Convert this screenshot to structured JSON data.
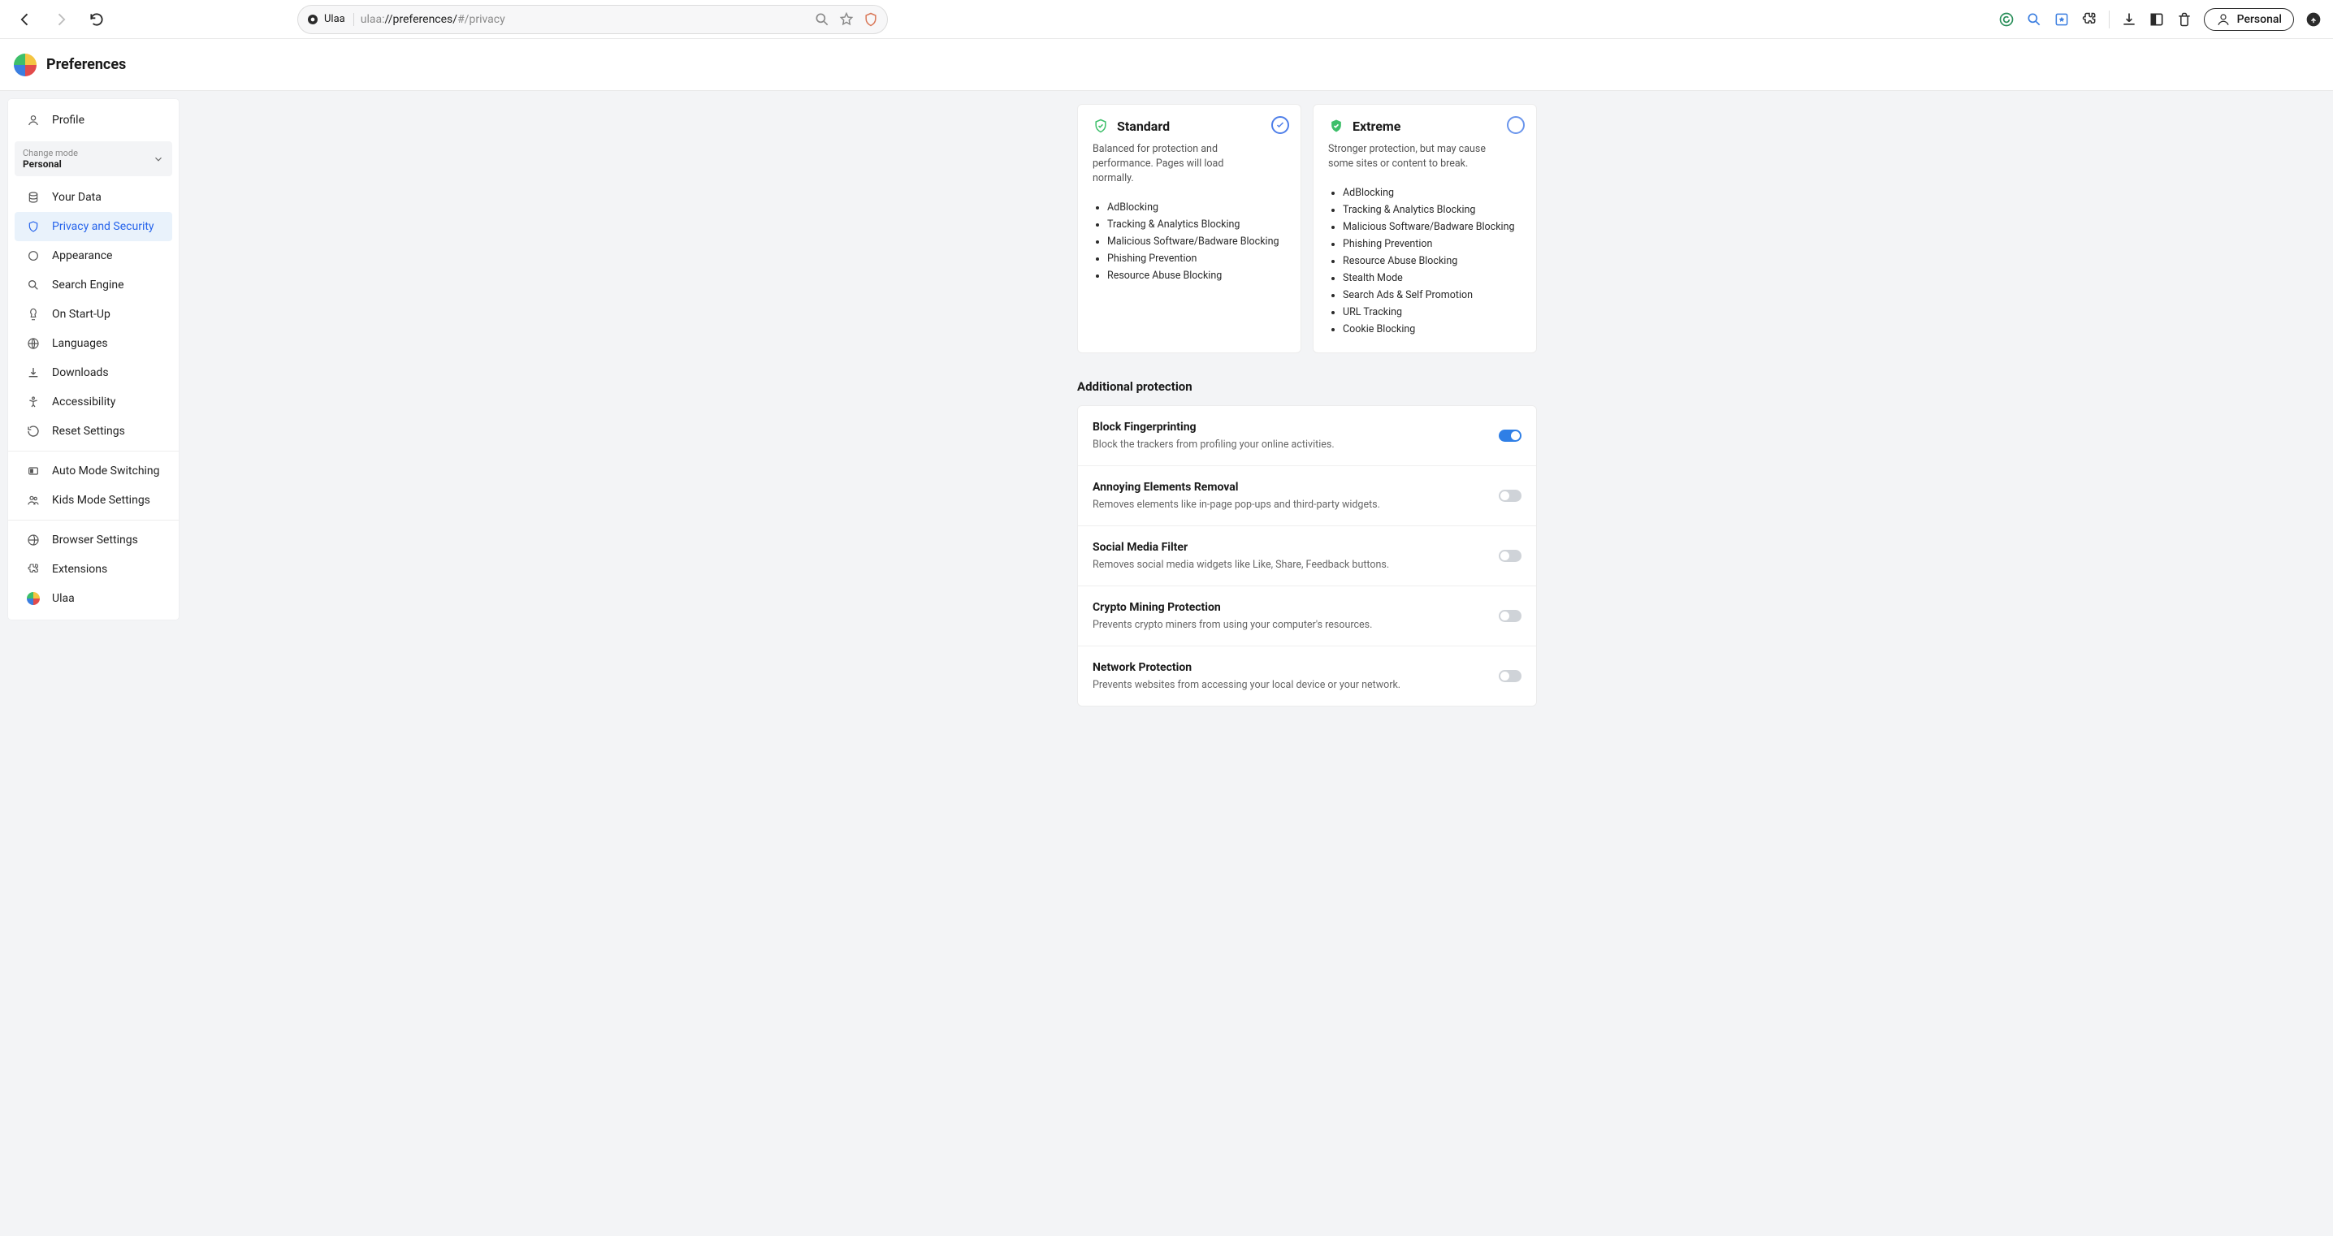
{
  "chrome": {
    "site_chip": "Ulaa",
    "url_scheme": "ulaa:",
    "url_host": "//preferences/",
    "url_path": "#/privacy",
    "profile_label": "Personal"
  },
  "app": {
    "title": "Preferences"
  },
  "sidebar": {
    "profile": "Profile",
    "mode_label": "Change mode",
    "mode_value": "Personal",
    "items": [
      {
        "label": "Your Data"
      },
      {
        "label": "Privacy and Security",
        "active": true
      },
      {
        "label": "Appearance"
      },
      {
        "label": "Search Engine"
      },
      {
        "label": "On Start-Up"
      },
      {
        "label": "Languages"
      },
      {
        "label": "Downloads"
      },
      {
        "label": "Accessibility"
      },
      {
        "label": "Reset Settings"
      }
    ],
    "group2": [
      {
        "label": "Auto Mode Switching"
      },
      {
        "label": "Kids Mode Settings"
      }
    ],
    "group3": [
      {
        "label": "Browser Settings"
      },
      {
        "label": "Extensions"
      },
      {
        "label": "Ulaa"
      }
    ]
  },
  "cards": {
    "standard": {
      "title": "Standard",
      "desc": "Balanced for protection and performance. Pages will load normally.",
      "features": [
        "AdBlocking",
        "Tracking & Analytics Blocking",
        "Malicious Software/Badware Blocking",
        "Phishing Prevention",
        "Resource Abuse Blocking"
      ],
      "selected": true
    },
    "extreme": {
      "title": "Extreme",
      "desc": "Stronger protection, but may cause some sites or content to break.",
      "features": [
        "AdBlocking",
        "Tracking & Analytics Blocking",
        "Malicious Software/Badware Blocking",
        "Phishing Prevention",
        "Resource Abuse Blocking",
        "Stealth Mode",
        "Search Ads & Self Promotion",
        "URL Tracking",
        "Cookie Blocking"
      ],
      "selected": false
    }
  },
  "additional": {
    "heading": "Additional protection",
    "toggles": [
      {
        "title": "Block Fingerprinting",
        "desc": "Block the trackers from profiling your online activities.",
        "on": true
      },
      {
        "title": "Annoying Elements Removal",
        "desc": "Removes elements like in-page pop-ups and third-party widgets.",
        "on": false
      },
      {
        "title": "Social Media Filter",
        "desc": "Removes social media widgets like Like, Share, Feedback buttons.",
        "on": false
      },
      {
        "title": "Crypto Mining Protection",
        "desc": "Prevents crypto miners from using your computer's resources.",
        "on": false
      },
      {
        "title": "Network Protection",
        "desc": "Prevents websites from accessing your local device or your network.",
        "on": false
      }
    ]
  }
}
